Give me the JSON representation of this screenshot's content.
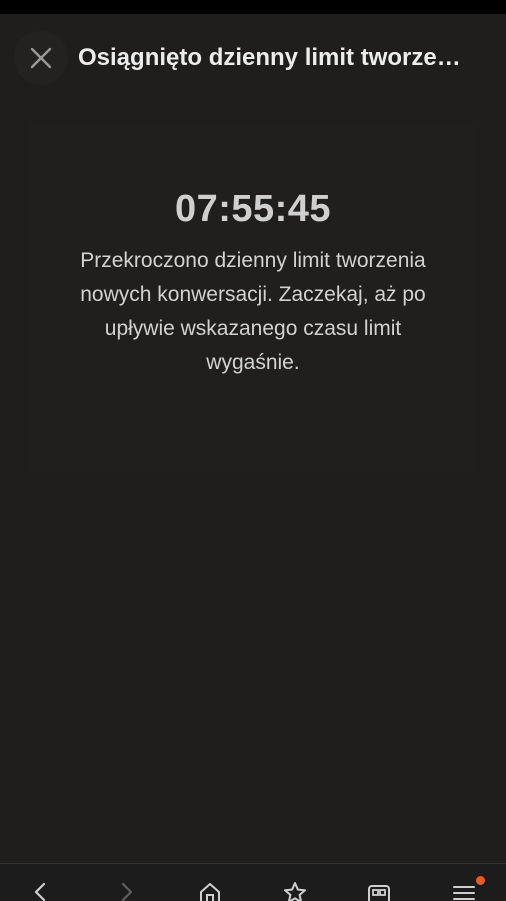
{
  "header": {
    "title": "Osiągnięto dzienny limit tworze…",
    "close_icon": "close-icon"
  },
  "limit": {
    "timer": "07:55:45",
    "message": "Przekroczono dzienny limit tworzenia nowych konwersacji. Zaczekaj, aż po upływie wskazanego czasu limit wygaśnie."
  },
  "bottom_nav": {
    "icons": [
      "back-icon",
      "forward-icon",
      "home-icon",
      "star-icon",
      "tabs-icon",
      "menu-icon"
    ],
    "notification_color": "#e85a2a"
  },
  "colors": {
    "background": "#1f1e1d",
    "text": "#e6e6e6"
  }
}
